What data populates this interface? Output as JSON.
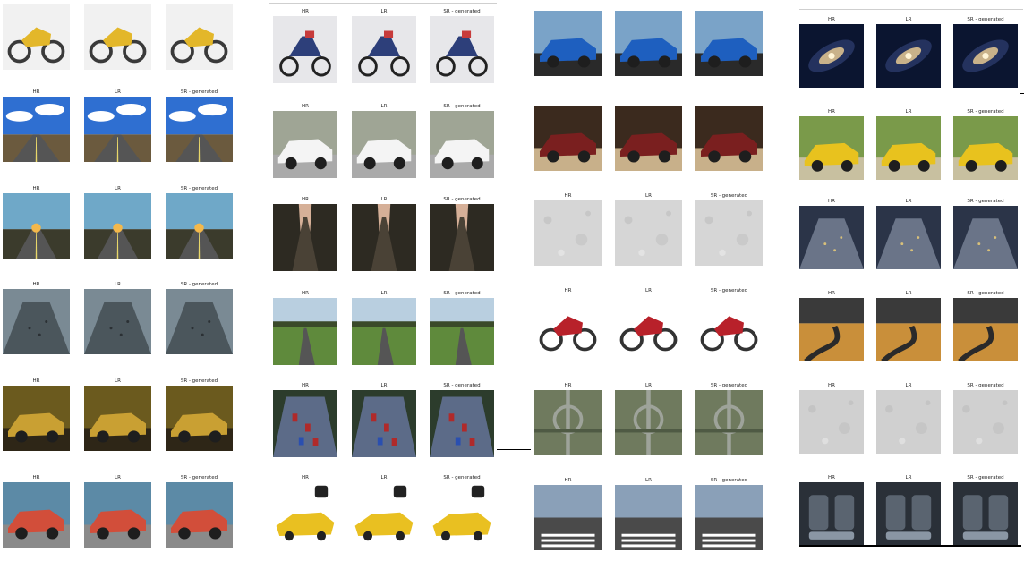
{
  "labels": {
    "hr": "HR",
    "lr": "LR",
    "sr": "SR - generated"
  },
  "panels": [
    {
      "id": "panel-1",
      "rows": [
        {
          "scene": "yellow-motorcycle",
          "label_row": false,
          "c1": "#e3b72a",
          "c2": "#3a3a3a",
          "c3": "#f1f1f1"
        },
        {
          "scene": "blue-sky-road",
          "label_row": true,
          "c1": "#2f6fd1",
          "c2": "#ffffff",
          "c3": "#6b5a3e"
        },
        {
          "scene": "sunset-road",
          "label_row": true,
          "c1": "#6fa8c8",
          "c2": "#f4b84b",
          "c3": "#3b3b2c"
        },
        {
          "scene": "night-highway",
          "label_row": true,
          "c1": "#7a8a94",
          "c2": "#4b565c",
          "c3": "#2b3034"
        },
        {
          "scene": "night-street-car",
          "label_row": true,
          "c1": "#6b5a1e",
          "c2": "#c9a033",
          "c3": "#2e2617"
        },
        {
          "scene": "red-vintage-car",
          "label_row": true,
          "c1": "#5c8aa6",
          "c2": "#d24e3a",
          "c3": "#8a8a8a"
        }
      ]
    },
    {
      "id": "panel-2",
      "rows": [
        {
          "scene": "scooter",
          "label_row": true,
          "c1": "#e7e7ea",
          "c2": "#2d3f7a",
          "c3": "#c73b3b"
        },
        {
          "scene": "white-car",
          "label_row": true,
          "c1": "#9fa595",
          "c2": "#f4f4f4",
          "c3": "#aaaaaa"
        },
        {
          "scene": "forest-road",
          "label_row": true,
          "c1": "#d6b098",
          "c2": "#2d2a22",
          "c3": "#4a4236"
        },
        {
          "scene": "country-road",
          "label_row": true,
          "c1": "#b9cfe0",
          "c2": "#5f8a3c",
          "c3": "#3a4a2a"
        },
        {
          "scene": "race-cars",
          "label_row": true,
          "c1": "#2c3c2c",
          "c2": "#b02a2a",
          "c3": "#5c6b88"
        },
        {
          "scene": "toy-car",
          "label_row": true,
          "c1": "#ffffff",
          "c2": "#e9c021",
          "c3": "#222222"
        }
      ]
    },
    {
      "id": "panel-3",
      "rows": [
        {
          "scene": "blue-sports-car",
          "label_row": false,
          "c1": "#7aa3c8",
          "c2": "#1e5fbf",
          "c3": "#2a2a2a"
        },
        {
          "scene": "dark-car-street",
          "label_row": false,
          "c1": "#3b2a1e",
          "c2": "#7a1f1f",
          "c3": "#c8b08a"
        },
        {
          "scene": "asphalt-texture",
          "label_row": true,
          "c1": "#d6d6d6",
          "c2": "#bdbdbd",
          "c3": "#e8e8e8"
        },
        {
          "scene": "red-motorcycle",
          "label_row": true,
          "c1": "#ffffff",
          "c2": "#b8212a",
          "c3": "#333333"
        },
        {
          "scene": "interchange",
          "label_row": true,
          "c1": "#6f7a5e",
          "c2": "#9ea39a",
          "c3": "#4f5a44"
        },
        {
          "scene": "crosswalk-street",
          "label_row": true,
          "c1": "#8aa0b8",
          "c2": "#4a4a4a",
          "c3": "#ffffff"
        }
      ]
    },
    {
      "id": "panel-4",
      "rows": [
        {
          "scene": "galaxy",
          "label_row": true,
          "c1": "#0b1530",
          "c2": "#c9b28a",
          "c3": "#2a3a6a"
        },
        {
          "scene": "yellow-car-grass",
          "label_row": true,
          "c1": "#7a9a4a",
          "c2": "#e8c21e",
          "c3": "#c8c0a0"
        },
        {
          "scene": "traffic-highway",
          "label_row": true,
          "c1": "#2b3448",
          "c2": "#6a7488",
          "c3": "#d8c07a"
        },
        {
          "scene": "winding-road",
          "label_row": true,
          "c1": "#3a3a3a",
          "c2": "#c98f3a",
          "c3": "#2a2a2a"
        },
        {
          "scene": "asphalt-texture",
          "label_row": true,
          "c1": "#d0d0d0",
          "c2": "#bcbcbc",
          "c3": "#e6e6e6"
        },
        {
          "scene": "car-interior",
          "label_row": true,
          "c1": "#2a3038",
          "c2": "#5a6470",
          "c3": "#8a96a4"
        }
      ]
    }
  ]
}
